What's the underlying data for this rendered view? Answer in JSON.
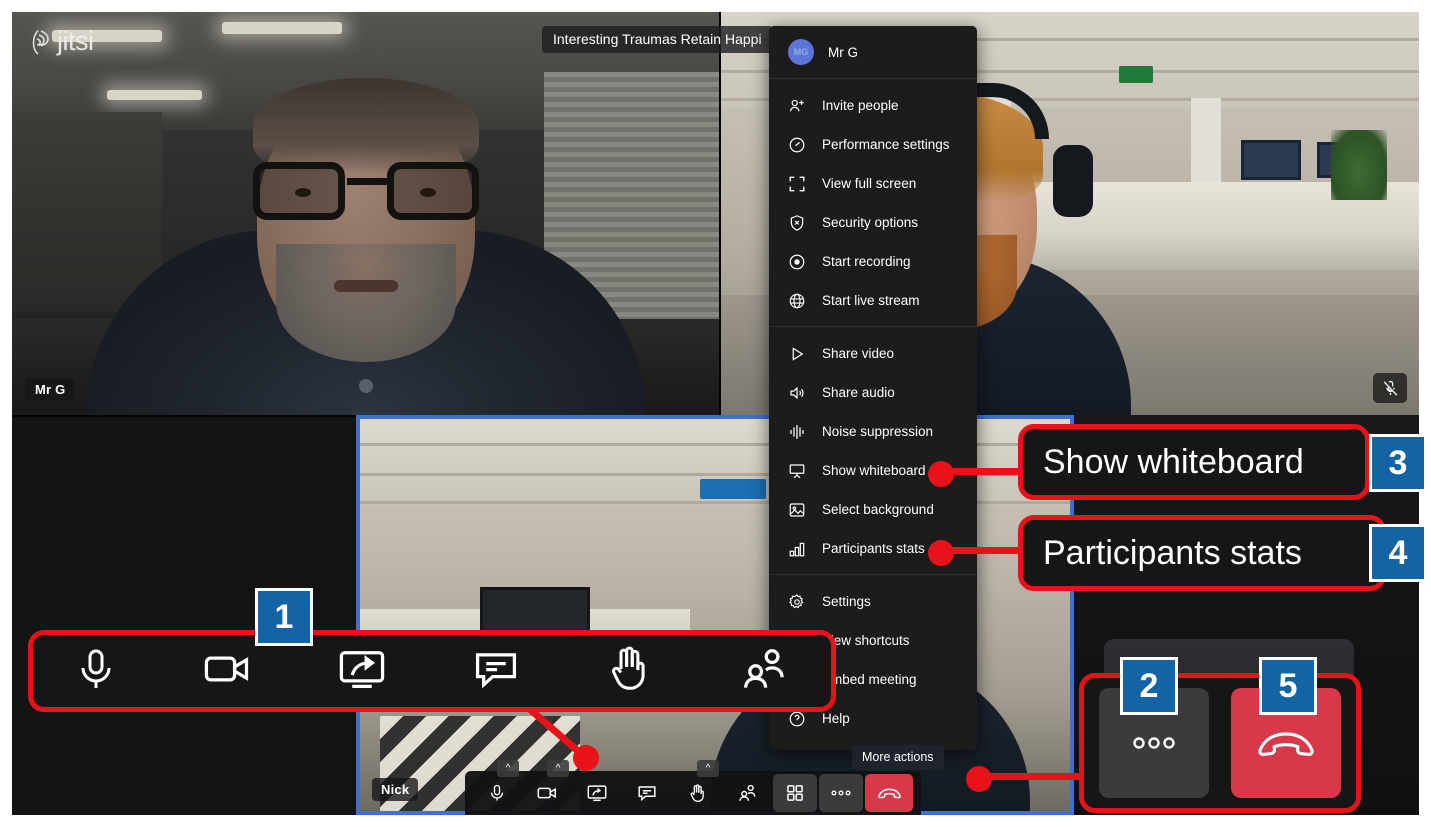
{
  "app": {
    "brand": "jitsi",
    "meeting_title": "Interesting Traumas Retain Happi",
    "tooltip_more_actions": "More actions"
  },
  "participants": [
    {
      "name": "Mr G",
      "position": "top-left",
      "muted": false
    },
    {
      "name": "",
      "position": "top-right",
      "muted": true
    },
    {
      "name": "Nick",
      "position": "bottom-center",
      "active_speaker": true
    },
    {
      "name": "",
      "position": "bottom-right",
      "muted": false
    }
  ],
  "overflow_menu": {
    "profile": {
      "initials": "MG",
      "display_name": "Mr G"
    },
    "groups": [
      {
        "items": [
          {
            "label": "Invite people",
            "icon": "add-person-icon"
          },
          {
            "label": "Performance settings",
            "icon": "gauge-icon"
          },
          {
            "label": "View full screen",
            "icon": "fullscreen-icon"
          },
          {
            "label": "Security options",
            "icon": "shield-icon"
          },
          {
            "label": "Start recording",
            "icon": "record-icon"
          },
          {
            "label": "Start live stream",
            "icon": "globe-icon"
          }
        ]
      },
      {
        "items": [
          {
            "label": "Share video",
            "icon": "play-icon"
          },
          {
            "label": "Share audio",
            "icon": "speaker-icon"
          },
          {
            "label": "Noise suppression",
            "icon": "waveform-icon"
          },
          {
            "label": "Show whiteboard",
            "icon": "whiteboard-icon"
          },
          {
            "label": "Select background",
            "icon": "image-icon"
          },
          {
            "label": "Participants stats",
            "icon": "bar-chart-icon"
          }
        ]
      },
      {
        "items": [
          {
            "label": "Settings",
            "icon": "gear-icon"
          },
          {
            "label": "View shortcuts",
            "icon": "keyboard-icon"
          },
          {
            "label": "Embed meeting",
            "icon": "embed-icon"
          },
          {
            "label": "Help",
            "icon": "help-icon"
          }
        ]
      }
    ]
  },
  "toolbar": {
    "buttons": [
      {
        "name": "microphone",
        "icon": "microphone-icon",
        "has_caret": true,
        "style": "plain"
      },
      {
        "name": "camera",
        "icon": "camera-icon",
        "has_caret": true,
        "style": "plain"
      },
      {
        "name": "share-screen",
        "icon": "screen-share-icon",
        "has_caret": false,
        "style": "plain"
      },
      {
        "name": "chat",
        "icon": "chat-icon",
        "has_caret": false,
        "style": "plain"
      },
      {
        "name": "raise-hand",
        "icon": "raised-hand-icon",
        "has_caret": true,
        "style": "plain"
      },
      {
        "name": "participants",
        "icon": "participants-icon",
        "has_caret": false,
        "style": "plain"
      },
      {
        "name": "tile-view",
        "icon": "tile-view-icon",
        "has_caret": false,
        "style": "grey"
      },
      {
        "name": "more-actions",
        "icon": "more-dots-icon",
        "has_caret": false,
        "style": "grey"
      },
      {
        "name": "hangup",
        "icon": "hangup-icon",
        "has_caret": false,
        "style": "red"
      }
    ]
  },
  "annotations": {
    "accent_red": "#E8121B",
    "badge_blue": "#1464A5",
    "items": [
      {
        "number": "1",
        "kind": "toolbar-zoom",
        "icons": [
          "microphone-icon",
          "camera-icon",
          "screen-share-icon",
          "chat-icon",
          "raised-hand-icon",
          "participants-icon"
        ]
      },
      {
        "number": "2",
        "kind": "button-zoom",
        "icon": "more-dots-icon"
      },
      {
        "number": "3",
        "kind": "menu-item-zoom",
        "label": "Show whiteboard"
      },
      {
        "number": "4",
        "kind": "menu-item-zoom",
        "label": "Participants stats"
      },
      {
        "number": "5",
        "kind": "button-zoom",
        "icon": "hangup-icon"
      }
    ]
  }
}
